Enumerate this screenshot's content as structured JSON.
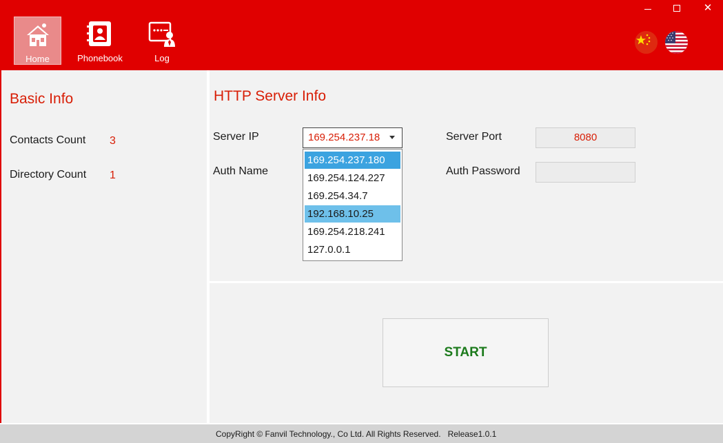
{
  "window": {
    "minimize_glyph": "—",
    "close_glyph": "✕"
  },
  "nav": {
    "items": [
      {
        "label": "Home",
        "icon": "home-icon",
        "active": true
      },
      {
        "label": "Phonebook",
        "icon": "phonebook-icon",
        "active": false
      },
      {
        "label": "Log",
        "icon": "log-icon",
        "active": false
      }
    ]
  },
  "languages": [
    {
      "name": "chinese-flag-icon"
    },
    {
      "name": "us-flag-icon"
    }
  ],
  "basic_info": {
    "title": "Basic Info",
    "contacts_count_label": "Contacts Count",
    "contacts_count_value": "3",
    "directory_count_label": "Directory Count",
    "directory_count_value": "1"
  },
  "http_server_info": {
    "title": "HTTP Server Info",
    "server_ip_label": "Server IP",
    "server_ip_value": "169.254.237.18",
    "server_port_label": "Server Port",
    "server_port_value": "8080",
    "auth_name_label": "Auth Name",
    "auth_password_label": "Auth Password",
    "auth_password_value": "",
    "ip_options": [
      "169.254.237.180",
      "169.254.124.227",
      "169.254.34.7",
      "192.168.10.25",
      "169.254.218.241",
      "127.0.0.1"
    ]
  },
  "actions": {
    "start_label": "START"
  },
  "footer": {
    "copyright": "CopyRight © Fanvil Technology., Co Ltd. All Rights Reserved.",
    "release": "Release1.0.1"
  },
  "colors": {
    "header_bg": "#e00000",
    "accent_text": "#d81e06",
    "start_text": "#1c7a1c",
    "selected_item": "#3ba3e0",
    "hover_item": "#6ec0ea"
  }
}
